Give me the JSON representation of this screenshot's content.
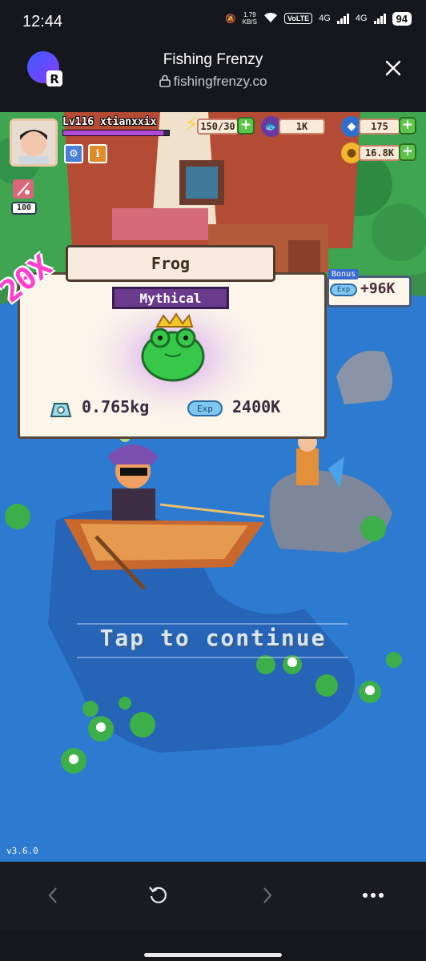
{
  "status_bar": {
    "time": "12:44",
    "net_speed_value": "1.79",
    "net_speed_unit": "KB/S",
    "volte": "VoLTE",
    "net_a": "4G",
    "net_b": "4G",
    "battery": "94"
  },
  "browser": {
    "title": "Fishing Frenzy",
    "url": "fishingfrenzy.co"
  },
  "hud": {
    "player": "Lv116 xtianxxix",
    "xp_fraction": 0.95,
    "energy": "150/30",
    "fish_count": "1K",
    "pearls": "175",
    "gold": "16.8K",
    "inventory_count": "100"
  },
  "catch": {
    "combo": "20X",
    "fish_name": "Frog",
    "rarity": "Mythical",
    "weight": "0.765kg",
    "exp_label": "Exp",
    "exp_value": "2400K",
    "bonus_label": "Bonus",
    "bonus_exp_label": "Exp",
    "bonus_value": "+96K"
  },
  "prompt": "Tap to continue",
  "version": "v3.6.0",
  "colors": {
    "water": "#2d7bd1",
    "rarity": "#6a3a8d",
    "combo": "#ff3fd0",
    "plus": "#5cc64a"
  }
}
